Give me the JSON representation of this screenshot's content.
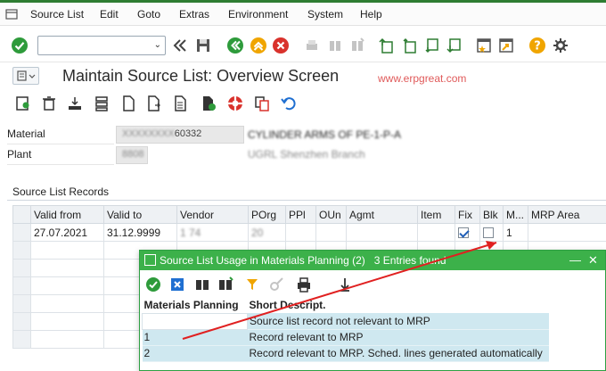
{
  "menubar": {
    "items": [
      "Source List",
      "Edit",
      "Goto",
      "Extras",
      "Environment",
      "System",
      "Help"
    ]
  },
  "title": {
    "text": "Maintain Source List: Overview Screen",
    "watermark": "www.erpgreat.com"
  },
  "header": {
    "material_label": "Material",
    "material_value": "60332",
    "material_desc": "CYLINDER ARMS OF PE-1-P-A",
    "plant_label": "Plant",
    "plant_value": "8808",
    "plant_desc": "UGRL Shenzhen Branch"
  },
  "records": {
    "group_title": "Source List Records",
    "columns": [
      "Valid from",
      "Valid to",
      "Vendor",
      "POrg",
      "PPl",
      "OUn",
      "Agmt",
      "Item",
      "Fix",
      "Blk",
      "M...",
      "MRP Area"
    ],
    "rows": [
      {
        "valid_from": "27.07.2021",
        "valid_to": "31.12.9999",
        "vendor": "1     74",
        "porg": "  20",
        "ppl": "",
        "oun": "",
        "agmt": "",
        "item": "",
        "mrp": "1",
        "mrp_area": ""
      }
    ]
  },
  "popup": {
    "title": "Source List Usage in Materials Planning (2)",
    "entries": "3 Entries found",
    "col_planning": "Materials Planning",
    "col_desc": "Short Descript.",
    "rows": [
      {
        "key": "",
        "desc": "Source list record not relevant to MRP"
      },
      {
        "key": "1",
        "desc": "Record relevant to MRP"
      },
      {
        "key": "2",
        "desc": "Record relevant to MRP. Sched. lines generated automatically"
      }
    ]
  },
  "colors": {
    "accent_green": "#3cb14a",
    "highlight_red": "#d32020",
    "selection_blue": "#cfe8f0"
  }
}
